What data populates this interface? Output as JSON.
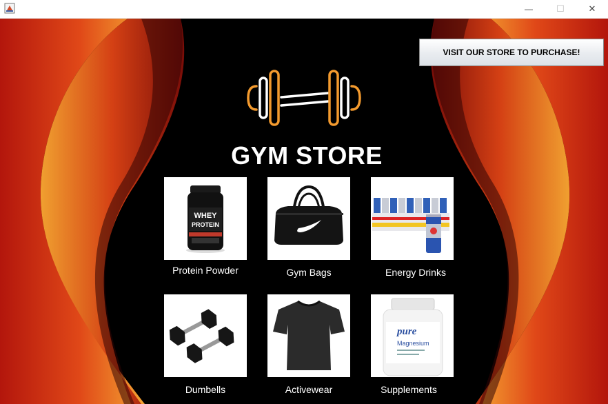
{
  "window": {
    "minimize_symbol": "—",
    "maximize_symbol": "☐",
    "close_symbol": "✕"
  },
  "header": {
    "purchase_button": "VISIT OUR STORE TO PURCHASE!",
    "title": "GYM STORE"
  },
  "products": [
    {
      "label": "Protein Powder",
      "jar_line1": "WHEY",
      "jar_line2": "PROTEIN"
    },
    {
      "label": "Gym Bags"
    },
    {
      "label": "Energy Drinks"
    },
    {
      "label": "Dumbells"
    },
    {
      "label": "Activewear"
    },
    {
      "label": "Supplements",
      "bottle_brand": "pure",
      "bottle_text": "Magnesium"
    }
  ],
  "colors": {
    "accent_orange": "#f39a2e",
    "background": "#000000",
    "flame_red": "#b8180e",
    "flame_orange": "#f0a030"
  }
}
